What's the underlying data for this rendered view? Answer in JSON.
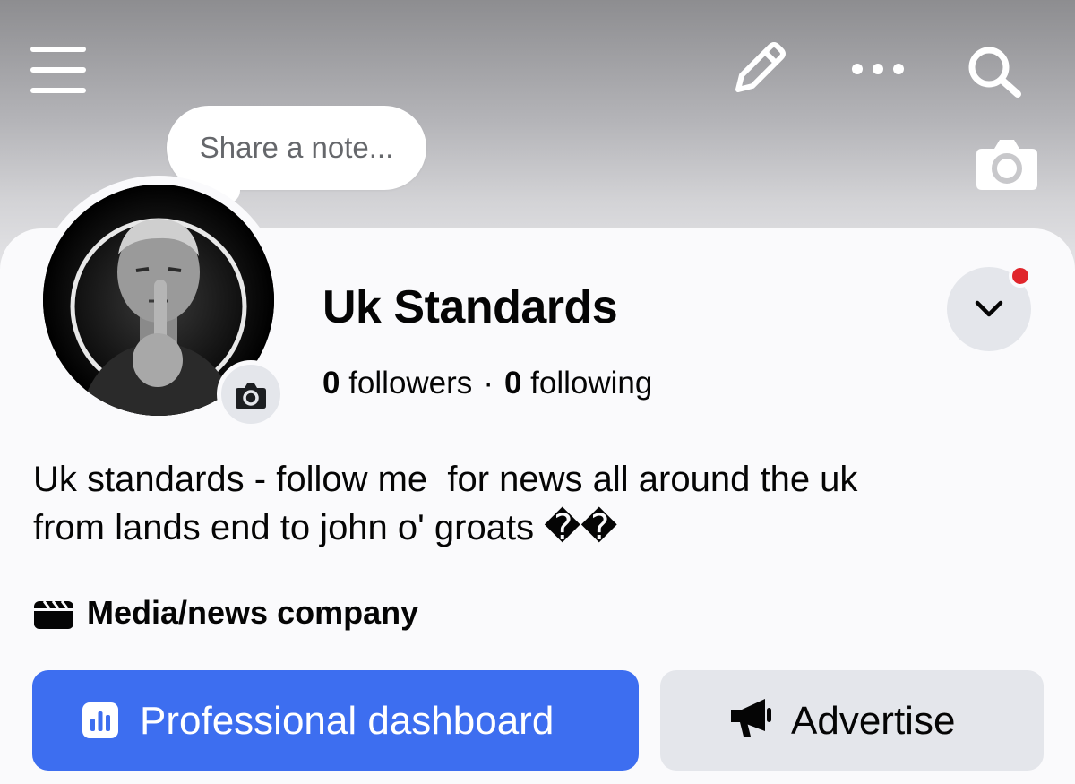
{
  "header": {
    "icons": [
      "menu-icon",
      "pencil-icon",
      "more-icon",
      "search-icon",
      "camera-icon"
    ]
  },
  "note": {
    "placeholder": "Share a note..."
  },
  "profile": {
    "name": "Uk Standards",
    "followers_count": "0",
    "followers_label": "followers",
    "separator": "·",
    "following_count": "0",
    "following_label": "following",
    "bio_line1": "Uk standards - follow me  for news all around the uk",
    "bio_line2": "from lands end to john o' groats ��",
    "category": "Media/news company"
  },
  "buttons": {
    "dashboard_label": "Professional dashboard",
    "advertise_label": "Advertise"
  },
  "colors": {
    "primary": "#3d6ef0",
    "secondary_bg": "#e4e6eb",
    "notification": "#e0252b"
  }
}
